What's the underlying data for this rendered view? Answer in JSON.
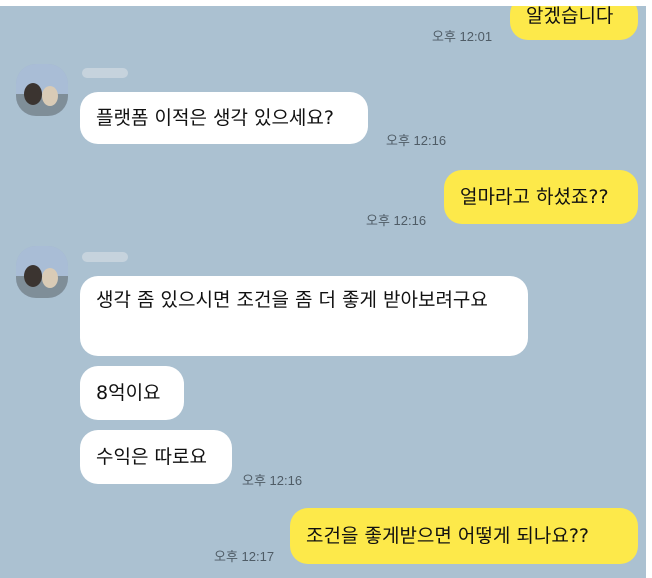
{
  "messages": [
    {
      "dir": "out",
      "text": "알겠습니다",
      "time": "오후 12:01"
    },
    {
      "dir": "in",
      "text": "플랫폼 이적은 생각 있으세요?",
      "time": "오후 12:16"
    },
    {
      "dir": "out",
      "text": "얼마라고 하셨죠??",
      "time": "오후 12:16"
    },
    {
      "dir": "in",
      "text": "생각 좀 있으시면 조건을 좀 더 좋게 받아보려구요"
    },
    {
      "dir": "in",
      "text": "8억이요"
    },
    {
      "dir": "in",
      "text": "수익은 따로요",
      "time": "오후 12:16"
    },
    {
      "dir": "out",
      "text": "조건을 좋게받으면 어떻게 되나요??",
      "time": "오후 12:17"
    }
  ],
  "colors": {
    "background": "#abc1d1",
    "incoming": "#ffffff",
    "outgoing": "#fde94a"
  }
}
